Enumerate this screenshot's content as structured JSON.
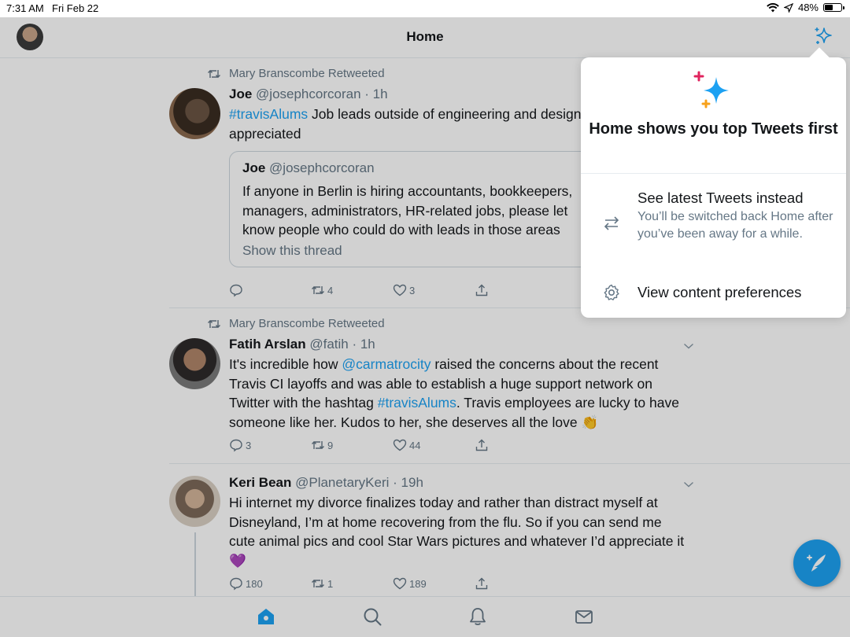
{
  "status_bar": {
    "time": "7:31 AM",
    "date": "Fri Feb 22",
    "battery": "48%",
    "battery_level": 0.48,
    "icons": [
      "wifi-icon",
      "location-icon",
      "battery-icon"
    ]
  },
  "header": {
    "title": "Home",
    "left_icon": "profile-avatar",
    "right_icon": "sparkle-icon"
  },
  "tweets": [
    {
      "retweeted_by": "Mary Branscombe Retweeted",
      "name": "Joe",
      "handle": "@josephcorcoran",
      "time": "1h",
      "text_link": "#travisAlums",
      "text_rest_line1": " Job leads outside of engineering and design",
      "text_rest_line2": "appreciated",
      "quote": {
        "name": "Joe",
        "handle": "@josephcorcoran",
        "line1": "If anyone in Berlin is hiring accountants, bookkeepers,",
        "line2": "managers, administrators, HR-related jobs, please let",
        "line3": "know people who could do with leads in those areas",
        "show_thread": "Show this thread"
      },
      "replies": "",
      "retweets": "4",
      "likes": "3"
    },
    {
      "retweeted_by": "Mary Branscombe Retweeted",
      "name": "Fatih Arslan",
      "handle": "@fatih",
      "time": "1h",
      "seg1": "It's incredible how ",
      "mention": "@carmatrocity",
      "seg2": " raised the concerns about the recent Travis CI layoffs and was able to establish a huge support network on Twitter with the hashtag ",
      "hashtag": "#travisAlums",
      "seg3": ". Travis employees are lucky to have someone like her. Kudos to her, she deserves all the love ",
      "emoji": "👏",
      "replies": "3",
      "retweets": "9",
      "likes": "44"
    },
    {
      "name": "Keri Bean",
      "handle": "@PlanetaryKeri",
      "time": "19h",
      "text": "Hi internet my divorce finalizes today and rather than distract myself at Disneyland, I’m at home recovering from the flu. So if you can send me cute animal pics and cool Star Wars pictures and whatever I’d appreciate it ",
      "emoji": "💜",
      "replies": "180",
      "retweets": "1",
      "likes": "189"
    }
  ],
  "popover": {
    "heading": "Home shows you top Tweets first",
    "option1_label": "See latest Tweets instead",
    "option1_sub": "You’ll be switched back Home after you’ve been away for a while.",
    "option2_label": "View content preferences"
  },
  "tab_bar": {
    "tabs": [
      "home-icon",
      "search-icon",
      "notifications-icon",
      "messages-icon"
    ]
  },
  "fab": {
    "icon": "compose-icon"
  },
  "colors": {
    "accent": "#1da1f2",
    "text": "#14171a",
    "secondary": "#657786"
  }
}
